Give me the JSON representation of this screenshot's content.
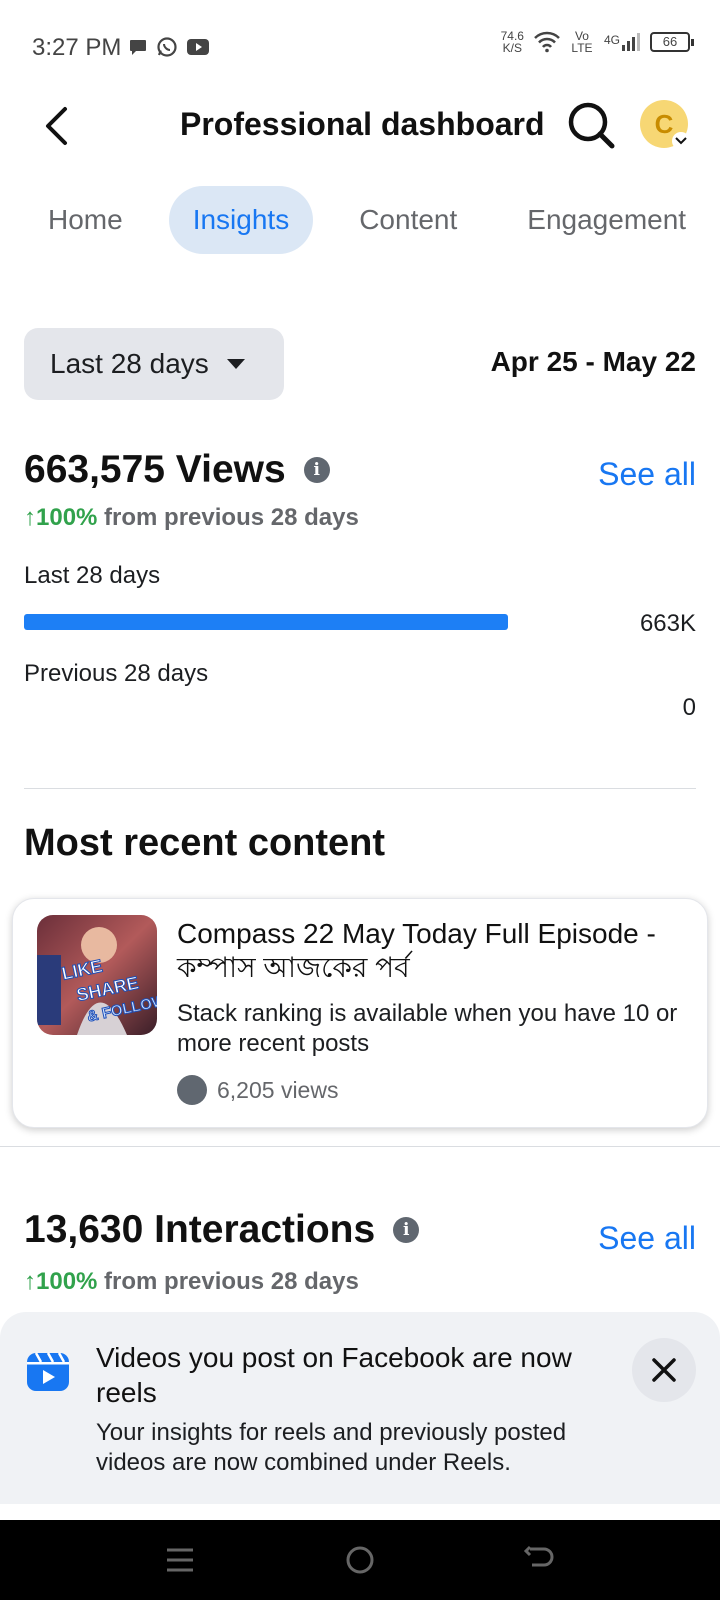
{
  "status_bar": {
    "time": "3:27 PM",
    "net_speed_value": "74.6",
    "net_speed_unit": "K/S",
    "volte_label": "Vo LTE",
    "network_label": "4G",
    "battery": "66"
  },
  "header": {
    "title": "Professional dashboard",
    "avatar_letter": "C"
  },
  "tabs": [
    {
      "label": "Home",
      "active": false
    },
    {
      "label": "Insights",
      "active": true
    },
    {
      "label": "Content",
      "active": false
    },
    {
      "label": "Engagement",
      "active": false
    }
  ],
  "filter": {
    "period_label": "Last 28 days",
    "date_range": "Apr 25 - May 22"
  },
  "views": {
    "title": "663,575 Views",
    "see_all": "See all",
    "change_arrow": "↑",
    "change_pct": "100%",
    "change_text": " from previous 28 days",
    "current_label": "Last 28 days",
    "current_value": "663K",
    "current_bar_fraction": 1.0,
    "previous_label": "Previous 28 days",
    "previous_value": "0"
  },
  "recent": {
    "section_title": "Most recent content",
    "post_title": "Compass 22 May Today Full Episode - কম্পাস আজকের পর্ব",
    "post_desc": "Stack ranking is available when you have 10 or more recent posts",
    "post_views": "6,205 views",
    "thumb_text": [
      "LIKE",
      "SHARE",
      "& FOLLOW"
    ]
  },
  "interactions": {
    "title": "13,630 Interactions",
    "see_all": "See all",
    "change_arrow": "↑",
    "change_pct": "100%",
    "change_text": " from previous 28 days"
  },
  "banner": {
    "title": "Videos you post on Facebook are now reels",
    "text": "Your insights for reels and previously posted videos are now combined under Reels."
  },
  "colors": {
    "accent": "#1877f2",
    "positive": "#31a24c",
    "bar": "#1d7ff5"
  }
}
